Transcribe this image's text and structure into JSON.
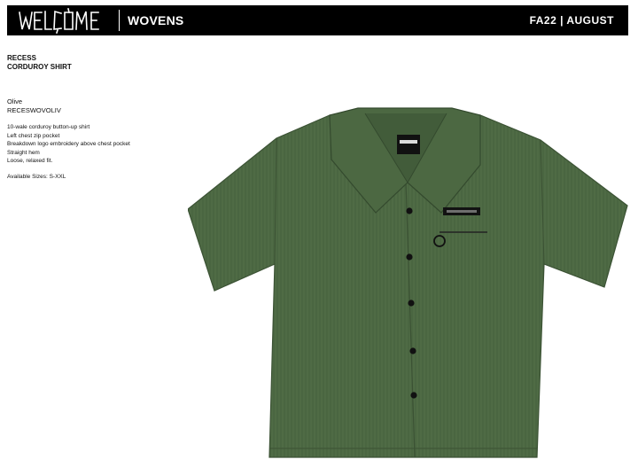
{
  "header": {
    "brand_logo_text": "WELCOME",
    "category": "WOVENS",
    "season": "FA22 | AUGUST"
  },
  "product": {
    "name_line1": "RECESS",
    "name_line2": "CORDUROY SHIRT",
    "color": "Olive",
    "sku": "RECESWOVOLIV",
    "features": [
      "10-wale corduroy button-up shirt",
      "Left chest zip pocket",
      "Breakdown logo embroidery above chest pocket",
      "Straight hem",
      "Loose, relaxed fit."
    ],
    "available_sizes": "Available Sizes: S-XXL"
  },
  "colors": {
    "header_bg": "#000000",
    "shirt_olive": "#4f6b45",
    "shirt_shadow": "#3f5838"
  }
}
